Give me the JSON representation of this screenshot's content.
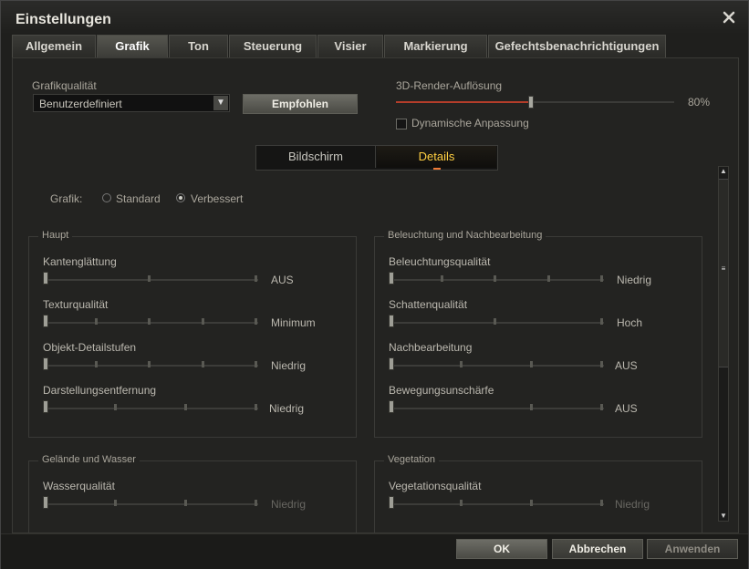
{
  "window": {
    "title": "Einstellungen",
    "close_icon": "close-icon"
  },
  "tabs": [
    {
      "label": "Allgemein"
    },
    {
      "label": "Grafik"
    },
    {
      "label": "Ton"
    },
    {
      "label": "Steuerung"
    },
    {
      "label": "Visier"
    },
    {
      "label": "Markierung"
    },
    {
      "label": "Gefechtsbenachrichtigungen"
    }
  ],
  "top": {
    "quality_label": "Grafikqualität",
    "quality_value": "Benutzerdefiniert",
    "recommended_label": "Empfohlen",
    "render_label": "3D-Render-Auflösung",
    "render_value": "80%",
    "dynamic_label": "Dynamische Anpassung"
  },
  "subtabs": {
    "screen": "Bildschirm",
    "details": "Details"
  },
  "graphics_mode": {
    "label": "Grafik:",
    "standard": "Standard",
    "improved": "Verbessert"
  },
  "groups": {
    "main": {
      "title": "Haupt",
      "items": [
        {
          "label": "Kantenglättung",
          "value": "AUS"
        },
        {
          "label": "Texturqualität",
          "value": "Minimum"
        },
        {
          "label": "Objekt-Detailstufen",
          "value": "Niedrig"
        },
        {
          "label": "Darstellungsentfernung",
          "value": "Niedrig"
        }
      ]
    },
    "lighting": {
      "title": "Beleuchtung und Nachbearbeitung",
      "items": [
        {
          "label": "Beleuchtungsqualität",
          "value": "Niedrig"
        },
        {
          "label": "Schattenqualität",
          "value": "Hoch"
        },
        {
          "label": "Nachbearbeitung",
          "value": "AUS"
        },
        {
          "label": "Bewegungsunschärfe",
          "value": "AUS"
        }
      ]
    },
    "terrain": {
      "title": "Gelände und Wasser",
      "items": [
        {
          "label": "Wasserqualität",
          "value": "Niedrig"
        }
      ]
    },
    "vegetation": {
      "title": "Vegetation",
      "items": [
        {
          "label": "Vegetationsqualität",
          "value": "Niedrig"
        }
      ]
    }
  },
  "footer": {
    "ok": "OK",
    "cancel": "Abbrechen",
    "apply": "Anwenden"
  }
}
